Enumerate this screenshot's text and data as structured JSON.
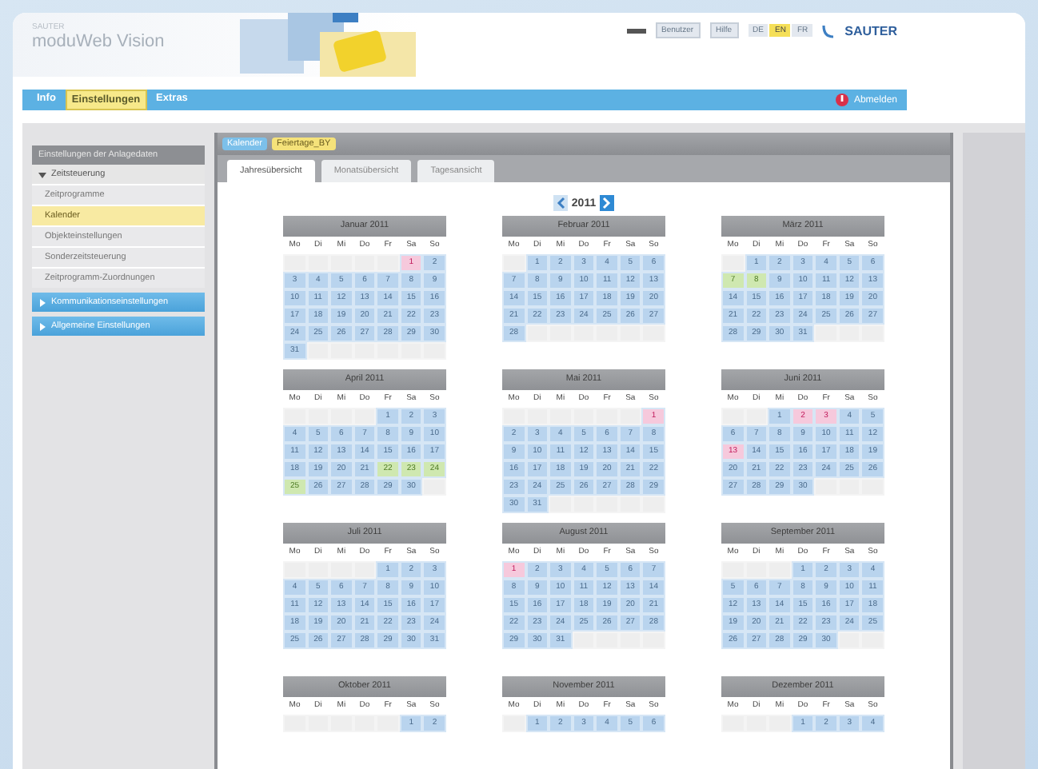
{
  "header": {
    "logo_small": "SAUTER",
    "logo": "moduWeb Vision",
    "user_button": "Benutzer",
    "help_button": "Hilfe",
    "languages": [
      {
        "label": "DE",
        "selected": false
      },
      {
        "label": "EN",
        "selected": true
      },
      {
        "label": "FR",
        "selected": false
      }
    ],
    "brand": "SAUTER"
  },
  "nav": {
    "items": [
      {
        "label": "Info",
        "selected": false
      },
      {
        "label": "Einstellungen",
        "selected": true
      },
      {
        "label": "Extras",
        "selected": false
      }
    ],
    "logout": "Abmelden"
  },
  "sidebar": {
    "title": "Einstellungen der Anlagedaten",
    "sections": [
      {
        "label": "Zeitsteuerung",
        "expanded": true,
        "children": [
          {
            "label": "Zeitprogramme",
            "selected": false
          },
          {
            "label": "Kalender",
            "selected": true
          },
          {
            "label": "Objekteinstellungen",
            "selected": false
          },
          {
            "label": "Sonderzeitsteuerung",
            "selected": false
          },
          {
            "label": "Zeitprogramm-Zuordnungen",
            "selected": false
          }
        ]
      },
      {
        "label": "Kommunikationseinstellungen",
        "expanded": false
      },
      {
        "label": "Allgemeine Einstellungen",
        "expanded": false
      }
    ]
  },
  "panel": {
    "breadcrumb": [
      {
        "label": "Kalender",
        "kind": "object"
      },
      {
        "label": "Feiertage_BY",
        "kind": "calendar"
      }
    ],
    "tabs": [
      {
        "label": "Jahresübersicht",
        "selected": true
      },
      {
        "label": "Monatsübersicht",
        "selected": false
      },
      {
        "label": "Tagesansicht",
        "selected": false
      }
    ],
    "year": "2011"
  },
  "calendar": {
    "months": [
      {
        "title": "Januar 2011",
        "weekdays": [
          "Mo",
          "Di",
          "Mi",
          "Do",
          "Fr",
          "Sa",
          "So"
        ],
        "weeks": [
          [
            {
              "kind": "blank"
            },
            {
              "kind": "blank"
            },
            {
              "kind": "blank"
            },
            {
              "kind": "blank"
            },
            {
              "kind": "blank"
            },
            {
              "day": "1",
              "kind": "holiday"
            },
            "2"
          ],
          [
            "3",
            "4",
            "5",
            "6",
            "7",
            "8",
            "9"
          ],
          [
            "10",
            "11",
            "12",
            "13",
            "14",
            "15",
            "16"
          ],
          [
            "17",
            "18",
            "19",
            "20",
            "21",
            "22",
            "23"
          ],
          [
            "24",
            "25",
            "26",
            "27",
            "28",
            "29",
            "30"
          ],
          [
            "31"
          ]
        ]
      },
      {
        "title": "Februar 2011",
        "weekdays": [
          "Mo",
          "Di",
          "Mi",
          "Do",
          "Fr",
          "Sa",
          "So"
        ],
        "weeks": [
          [
            {
              "kind": "blank"
            },
            "1",
            "2",
            "3",
            "4",
            "5",
            "6"
          ],
          [
            "7",
            "8",
            "9",
            "10",
            "11",
            "12",
            "13"
          ],
          [
            "14",
            "15",
            "16",
            "17",
            "18",
            "19",
            "20"
          ],
          [
            "21",
            "22",
            "23",
            "24",
            "25",
            "26",
            "27"
          ],
          [
            "28"
          ]
        ]
      },
      {
        "title": "März 2011",
        "weekdays": [
          "Mo",
          "Di",
          "Mi",
          "Do",
          "Fr",
          "Sa",
          "So"
        ],
        "weeks": [
          [
            {
              "kind": "blank"
            },
            "1",
            "2",
            "3",
            "4",
            "5",
            "6"
          ],
          [
            {
              "day": "7",
              "kind": "special"
            },
            {
              "day": "8",
              "kind": "special"
            },
            "9",
            "10",
            "11",
            "12",
            "13"
          ],
          [
            "14",
            "15",
            "16",
            "17",
            "18",
            "19",
            "20"
          ],
          [
            "21",
            "22",
            "23",
            "24",
            "25",
            "26",
            "27"
          ],
          [
            "28",
            "29",
            "30",
            "31"
          ]
        ]
      },
      {
        "title": "April 2011",
        "weekdays": [
          "Mo",
          "Di",
          "Mi",
          "Do",
          "Fr",
          "Sa",
          "So"
        ],
        "weeks": [
          [
            {
              "kind": "blank"
            },
            {
              "kind": "blank"
            },
            {
              "kind": "blank"
            },
            {
              "kind": "blank"
            },
            "1",
            "2",
            "3"
          ],
          [
            "4",
            "5",
            "6",
            "7",
            "8",
            "9",
            "10"
          ],
          [
            "11",
            "12",
            "13",
            "14",
            "15",
            "16",
            "17"
          ],
          [
            "18",
            "19",
            "20",
            "21",
            {
              "day": "22",
              "kind": "special"
            },
            {
              "day": "23",
              "kind": "special"
            },
            {
              "day": "24",
              "kind": "special"
            }
          ],
          [
            {
              "day": "25",
              "kind": "special"
            },
            "26",
            "27",
            "28",
            "29",
            "30"
          ]
        ]
      },
      {
        "title": "Mai 2011",
        "weekdays": [
          "Mo",
          "Di",
          "Mi",
          "Do",
          "Fr",
          "Sa",
          "So"
        ],
        "weeks": [
          [
            {
              "kind": "blank"
            },
            {
              "kind": "blank"
            },
            {
              "kind": "blank"
            },
            {
              "kind": "blank"
            },
            {
              "kind": "blank"
            },
            {
              "kind": "blank"
            },
            {
              "day": "1",
              "kind": "holiday"
            }
          ],
          [
            "2",
            "3",
            "4",
            "5",
            "6",
            "7",
            "8"
          ],
          [
            "9",
            "10",
            "11",
            "12",
            "13",
            "14",
            "15"
          ],
          [
            "16",
            "17",
            "18",
            "19",
            "20",
            "21",
            "22"
          ],
          [
            "23",
            "24",
            "25",
            "26",
            "27",
            "28",
            "29"
          ],
          [
            "30",
            "31"
          ]
        ]
      },
      {
        "title": "Juni 2011",
        "weekdays": [
          "Mo",
          "Di",
          "Mi",
          "Do",
          "Fr",
          "Sa",
          "So"
        ],
        "weeks": [
          [
            {
              "kind": "blank"
            },
            {
              "kind": "blank"
            },
            "1",
            {
              "day": "2",
              "kind": "holiday"
            },
            {
              "day": "3",
              "kind": "holiday"
            },
            "4",
            "5"
          ],
          [
            "6",
            "7",
            "8",
            "9",
            "10",
            "11",
            "12"
          ],
          [
            {
              "day": "13",
              "kind": "holiday"
            },
            "14",
            "15",
            "16",
            "17",
            "18",
            "19"
          ],
          [
            "20",
            "21",
            "22",
            "23",
            "24",
            "25",
            "26"
          ],
          [
            "27",
            "28",
            "29",
            "30"
          ]
        ]
      },
      {
        "title": "Juli 2011",
        "weekdays": [
          "Mo",
          "Di",
          "Mi",
          "Do",
          "Fr",
          "Sa",
          "So"
        ],
        "weeks": [
          [
            {
              "kind": "blank"
            },
            {
              "kind": "blank"
            },
            {
              "kind": "blank"
            },
            {
              "kind": "blank"
            },
            "1",
            "2",
            "3"
          ],
          [
            "4",
            "5",
            "6",
            "7",
            "8",
            "9",
            "10"
          ],
          [
            "11",
            "12",
            "13",
            "14",
            "15",
            "16",
            "17"
          ],
          [
            "18",
            "19",
            "20",
            "21",
            "22",
            "23",
            "24"
          ],
          [
            "25",
            "26",
            "27",
            "28",
            "29",
            "30",
            "31"
          ]
        ]
      },
      {
        "title": "August 2011",
        "weekdays": [
          "Mo",
          "Di",
          "Mi",
          "Do",
          "Fr",
          "Sa",
          "So"
        ],
        "weeks": [
          [
            {
              "day": "1",
              "kind": "holiday"
            },
            "2",
            "3",
            "4",
            "5",
            "6",
            "7"
          ],
          [
            "8",
            "9",
            "10",
            "11",
            "12",
            "13",
            "14"
          ],
          [
            "15",
            "16",
            "17",
            "18",
            "19",
            "20",
            "21"
          ],
          [
            "22",
            "23",
            "24",
            "25",
            "26",
            "27",
            "28"
          ],
          [
            "29",
            "30",
            "31"
          ]
        ]
      },
      {
        "title": "September 2011",
        "weekdays": [
          "Mo",
          "Di",
          "Mi",
          "Do",
          "Fr",
          "Sa",
          "So"
        ],
        "weeks": [
          [
            {
              "kind": "blank"
            },
            {
              "kind": "blank"
            },
            {
              "kind": "blank"
            },
            "1",
            "2",
            "3",
            "4"
          ],
          [
            "5",
            "6",
            "7",
            "8",
            "9",
            "10",
            "11"
          ],
          [
            "12",
            "13",
            "14",
            "15",
            "16",
            "17",
            "18"
          ],
          [
            "19",
            "20",
            "21",
            "22",
            "23",
            "24",
            "25"
          ],
          [
            "26",
            "27",
            "28",
            "29",
            "30"
          ]
        ]
      },
      {
        "title": "Oktober 2011",
        "weekdays": [
          "Mo",
          "Di",
          "Mi",
          "Do",
          "Fr",
          "Sa",
          "So"
        ],
        "weeks": [
          [
            {
              "kind": "blank"
            },
            {
              "kind": "blank"
            },
            {
              "kind": "blank"
            },
            {
              "kind": "blank"
            },
            {
              "kind": "blank"
            },
            "1",
            "2"
          ]
        ]
      },
      {
        "title": "November 2011",
        "weekdays": [
          "Mo",
          "Di",
          "Mi",
          "Do",
          "Fr",
          "Sa",
          "So"
        ],
        "weeks": [
          [
            {
              "kind": "blank"
            },
            "1",
            "2",
            "3",
            "4",
            "5",
            "6"
          ]
        ]
      },
      {
        "title": "Dezember 2011",
        "weekdays": [
          "Mo",
          "Di",
          "Mi",
          "Do",
          "Fr",
          "Sa",
          "So"
        ],
        "weeks": [
          [
            {
              "kind": "blank"
            },
            {
              "kind": "blank"
            },
            {
              "kind": "blank"
            },
            "1",
            "2",
            "3",
            "4"
          ]
        ]
      }
    ]
  }
}
